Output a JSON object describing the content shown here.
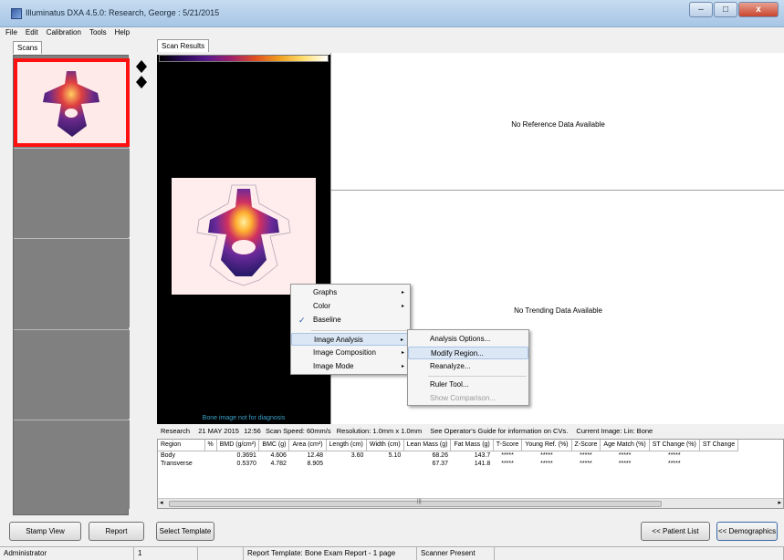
{
  "window": {
    "title": "Illuminatus DXA 4.5.0: Research, George : 5/21/2015",
    "min": "–",
    "max": "□",
    "close": "x"
  },
  "menubar": [
    "File",
    "Edit",
    "Calibration",
    "Tools",
    "Help"
  ],
  "tabs": {
    "scans": "Scans",
    "scan_results": "Scan Results"
  },
  "image": {
    "note": "Bone image not for diagnosis"
  },
  "results": {
    "reference_msg": "No Reference Data Available",
    "trending_msg": "No Trending Data Available"
  },
  "scan_info": {
    "study": "Research",
    "date": "21 MAY 2015",
    "time": "12:56",
    "speed": "Scan Speed: 60mm/s",
    "resolution": "Resolution: 1.0mm x 1.0mm",
    "guide": "See Operator's Guide for information on CVs.",
    "current_image": "Current Image: Lin: Bone"
  },
  "table": {
    "headers": [
      "Region",
      "%",
      "BMD (g/cm²)",
      "BMC (g)",
      "Area (cm²)",
      "Length (cm)",
      "Width (cm)",
      "Lean Mass (g)",
      "Fat Mass (g)",
      "T-Score",
      "Young Ref. (%)",
      "Z-Score",
      "Age Match (%)",
      "ST Change (%)",
      "ST Change"
    ],
    "rows": [
      [
        "Body",
        "",
        "0.3691",
        "4.606",
        "12.48",
        "3.60",
        "5.10",
        "68.26",
        "143.7",
        "*****",
        "*****",
        "*****",
        "*****",
        "*****",
        ""
      ],
      [
        "Transverse",
        "",
        "0.5370",
        "4.782",
        "8.905",
        "",
        "",
        "67.37",
        "141.8",
        "*****",
        "*****",
        "*****",
        "*****",
        "*****",
        ""
      ]
    ]
  },
  "context_menu": {
    "items": [
      {
        "label": "Graphs",
        "submenu": true
      },
      {
        "label": "Color",
        "submenu": true
      },
      {
        "label": "Baseline",
        "checked": true
      },
      {
        "label": "Image Analysis",
        "submenu": true,
        "highlighted": true
      },
      {
        "label": "Image Composition",
        "submenu": true
      },
      {
        "label": "Image Mode",
        "submenu": true
      }
    ]
  },
  "submenu": {
    "items": [
      {
        "label": "Analysis Options..."
      },
      {
        "label": "Modify Region...",
        "highlighted": true
      },
      {
        "label": "Reanalyze..."
      },
      {
        "label": "Ruler Tool..."
      },
      {
        "label": "Show Comparison...",
        "disabled": true
      }
    ]
  },
  "buttons": {
    "stamp_view": "Stamp View",
    "report": "Report",
    "select_template": "Select Template",
    "patient_list": "<< Patient List",
    "demographics": "<< Demographics"
  },
  "status": {
    "user": "Administrator",
    "count": "1",
    "template": "Report Template: Bone Exam Report - 1 page",
    "scanner": "Scanner Present"
  },
  "colors": {
    "selection_border": "#ff1010",
    "menu_highlight": "#dbe7f5",
    "bone_note": "#3aa0c8"
  }
}
